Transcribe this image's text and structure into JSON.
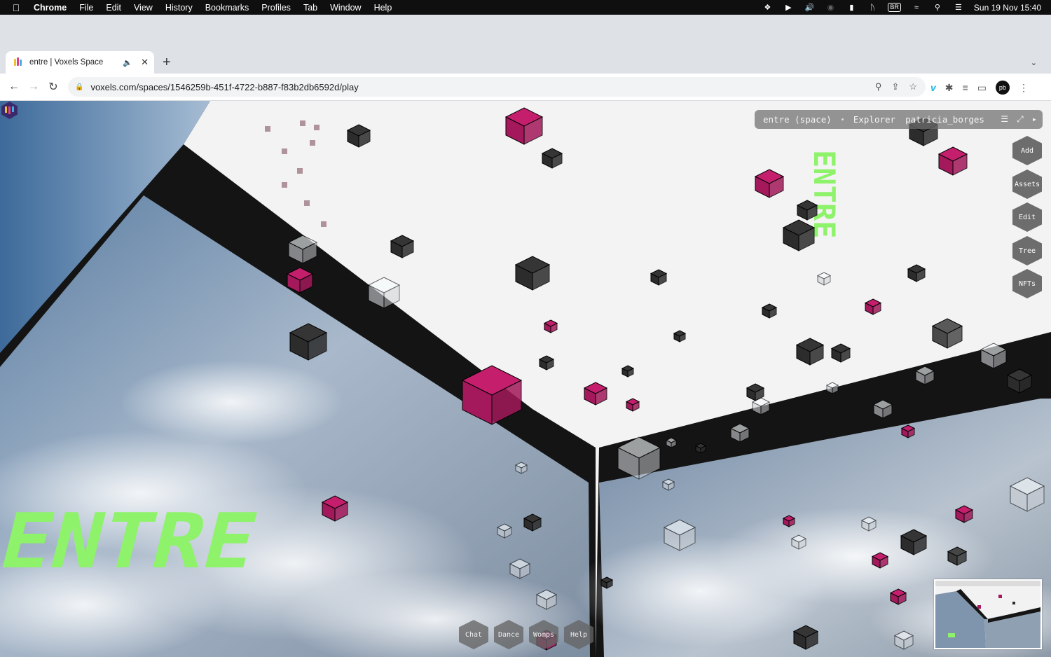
{
  "menubar": {
    "app": "Chrome",
    "items": [
      "File",
      "Edit",
      "View",
      "History",
      "Bookmarks",
      "Profiles",
      "Tab",
      "Window",
      "Help"
    ],
    "input_source": "BR",
    "clock": "Sun 19 Nov  15:40"
  },
  "tab": {
    "title": "entre | Voxels Space",
    "new_tab": "+"
  },
  "address": {
    "url": "voxels.com/spaces/1546259b-451f-4722-b887-f83b2db6592d/play"
  },
  "space": {
    "name": "entre (space)",
    "explorer": "Explorer",
    "owner": "patricia_borges"
  },
  "side_buttons": [
    "Add",
    "Assets",
    "Edit",
    "Tree",
    "NFTs"
  ],
  "bottom_buttons": [
    "Chat",
    "Dance",
    "Womps",
    "Help"
  ],
  "sign_text": "ENTRE",
  "colors": {
    "accent_magenta": "#a3195b",
    "cube_dark": "#2c2c2c",
    "sign_green": "#8ef26a",
    "sky_blue": "#6f8fb0"
  }
}
